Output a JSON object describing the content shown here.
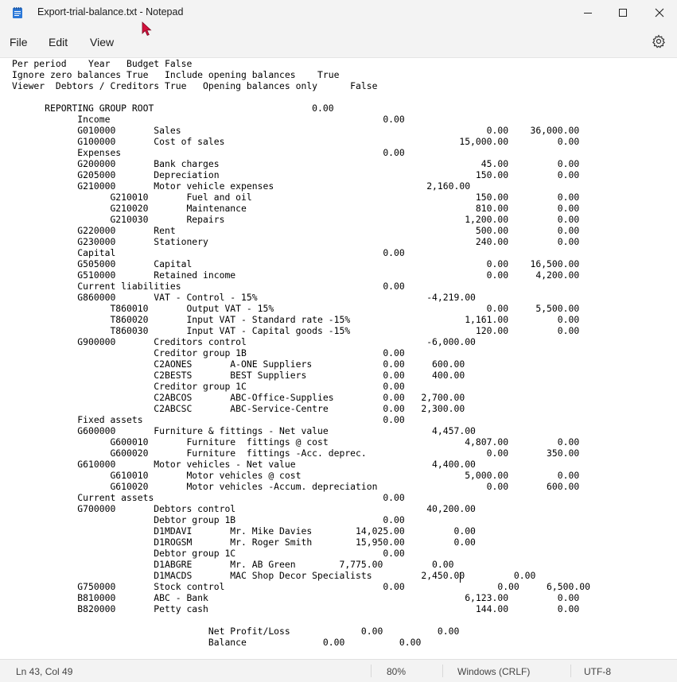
{
  "window": {
    "title": "Export-trial-balance.txt - Notepad"
  },
  "icons": {
    "app": "notepad-icon",
    "minimize": "minimize-icon",
    "maximize": "maximize-icon",
    "close": "close-icon",
    "settings": "gear-icon",
    "pointer": "mouse-pointer-icon"
  },
  "colors": {
    "pointer": "#d4103c",
    "app_icon": "#2b78d8"
  },
  "menu": {
    "items": [
      "File",
      "Edit",
      "View"
    ]
  },
  "document": {
    "lines": [
      "Per period    Year   Budget False",
      "Ignore zero balances True   Include opening balances    True",
      "Viewer  Debtors / Creditors True   Opening balances only      False",
      "",
      "      REPORTING GROUP ROOT                             0.00",
      "            Income                                                  0.00",
      "            G010000       Sales                                                        0.00    36,000.00",
      "            G100000       Cost of sales                                           15,000.00         0.00",
      "            Expenses                                                0.00",
      "            G200000       Bank charges                                                45.00         0.00",
      "            G205000       Depreciation                                               150.00         0.00",
      "            G210000       Motor vehicle expenses                            2,160.00",
      "                  G210010       Fuel and oil                                         150.00         0.00",
      "                  G210020       Maintenance                                          810.00         0.00",
      "                  G210030       Repairs                                            1,200.00         0.00",
      "            G220000       Rent                                                       500.00         0.00",
      "            G230000       Stationery                                                 240.00         0.00",
      "            Capital                                                 0.00",
      "            G505000       Capital                                                      0.00    16,500.00",
      "            G510000       Retained income                                              0.00     4,200.00",
      "            Current liabilities                                     0.00",
      "            G860000       VAT - Control - 15%                               -4,219.00",
      "                  T860010       Output VAT - 15%                                       0.00     5,500.00",
      "                  T860020       Input VAT - Standard rate -15%                     1,161.00         0.00",
      "                  T860030       Input VAT - Capital goods -15%                       120.00         0.00",
      "            G900000       Creditors control                                 -6,000.00",
      "                          Creditor group 1B                         0.00",
      "                          C2AONES       A-ONE Suppliers             0.00     600.00",
      "                          C2BESTS       BEST Suppliers              0.00     400.00",
      "                          Creditor group 1C                         0.00",
      "                          C2ABCOS       ABC-Office-Supplies         0.00   2,700.00",
      "                          C2ABCSC       ABC-Service-Centre          0.00   2,300.00",
      "            Fixed assets                                            0.00",
      "            G600000       Furniture & fittings - Net value                   4,457.00",
      "                  G600010       Furniture  fittings @ cost                         4,807.00         0.00",
      "                  G600020       Furniture  fittings -Acc. deprec.                      0.00       350.00",
      "            G610000       Motor vehicles - Net value                         4,400.00",
      "                  G610010       Motor vehicles @ cost                              5,000.00         0.00",
      "                  G610020       Motor vehicles -Accum. depreciation                    0.00       600.00",
      "            Current assets                                          0.00",
      "            G700000       Debtors control                                   40,200.00",
      "                          Debtor group 1B                           0.00",
      "                          D1MDAVI       Mr. Mike Davies        14,025.00         0.00",
      "                          D1ROGSM       Mr. Roger Smith        15,950.00         0.00",
      "                          Debtor group 1C                           0.00",
      "                          D1ABGRE       Mr. AB Green        7,775.00         0.00",
      "                          D1MACDS       MAC Shop Decor Specialists         2,450.00         0.00",
      "            G750000       Stock control                             0.00                 0.00     6,500.00",
      "            B810000       ABC - Bank                                               6,123.00         0.00",
      "            B820000       Petty cash                                                 144.00         0.00",
      "",
      "                                    Net Profit/Loss             0.00          0.00",
      "                                    Balance              0.00          0.00"
    ]
  },
  "status": {
    "position": "Ln 43, Col 49",
    "zoom": "80%",
    "line_ending": "Windows (CRLF)",
    "encoding": "UTF-8"
  }
}
